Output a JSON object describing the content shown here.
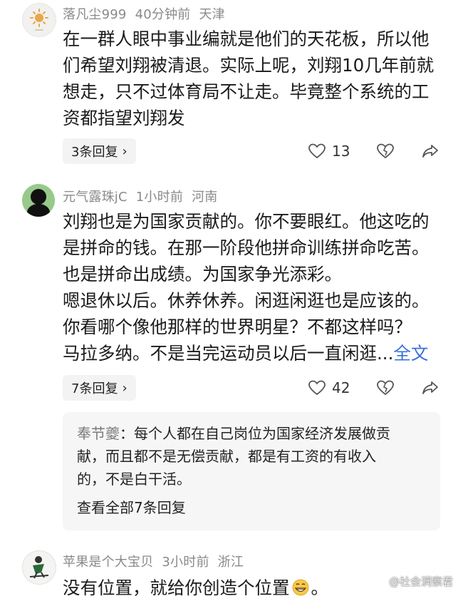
{
  "comments": [
    {
      "username": "落凡尘999",
      "time": "40分钟前",
      "location": "天津",
      "lines": [
        "在一群人眼中事业编就是他们的天花板，所以他",
        "们希望刘翔被清退。实际上呢，刘翔10几年前就",
        "想走，只不过体育局不让走。毕竟整个系统的工",
        "资都指望刘翔发"
      ],
      "reply_label": "3条回复",
      "likes": "13"
    },
    {
      "username": "元气露珠jC",
      "time": "1小时前",
      "location": "河南",
      "lines": [
        "刘翔也是为国家贡献的。你不要眼红。他这吃的",
        "是拼命的钱。在那一阶段他拼命训练拼命吃苦。",
        "也是拼命出成绩。为国家争光添彩。",
        "嗯退休以后。休养休养。闲逛闲逛也是应该的。",
        "你看哪个像他那样的世界明星？不都这样吗？",
        "马拉多纳。不是当完运动员以后一直闲逛..."
      ],
      "more_label": "全文",
      "reply_label": "7条回复",
      "likes": "42",
      "sub_reply": {
        "name": "奉节夔",
        "lines": [
          "：每个人都在自己岗位为国家经济发展做贡",
          "献，而且都不是无偿贡献，都是有工资的有收入",
          "的，不是白干活。"
        ],
        "view_all": "查看全部7条回复"
      }
    },
    {
      "username": "苹果是个大宝贝",
      "time": "3小时前",
      "location": "浙江",
      "text": "没有位置，就给你创造个位置",
      "emoji_name": "grinning-emoji",
      "text_end": "。"
    }
  ],
  "watermark": "@社会洞察君",
  "colors": {
    "meta": "#8a8a8a",
    "link": "#3b6fd8",
    "reply_bg": "#f3f3f3",
    "sub_box_bg": "#f6f6f6"
  }
}
